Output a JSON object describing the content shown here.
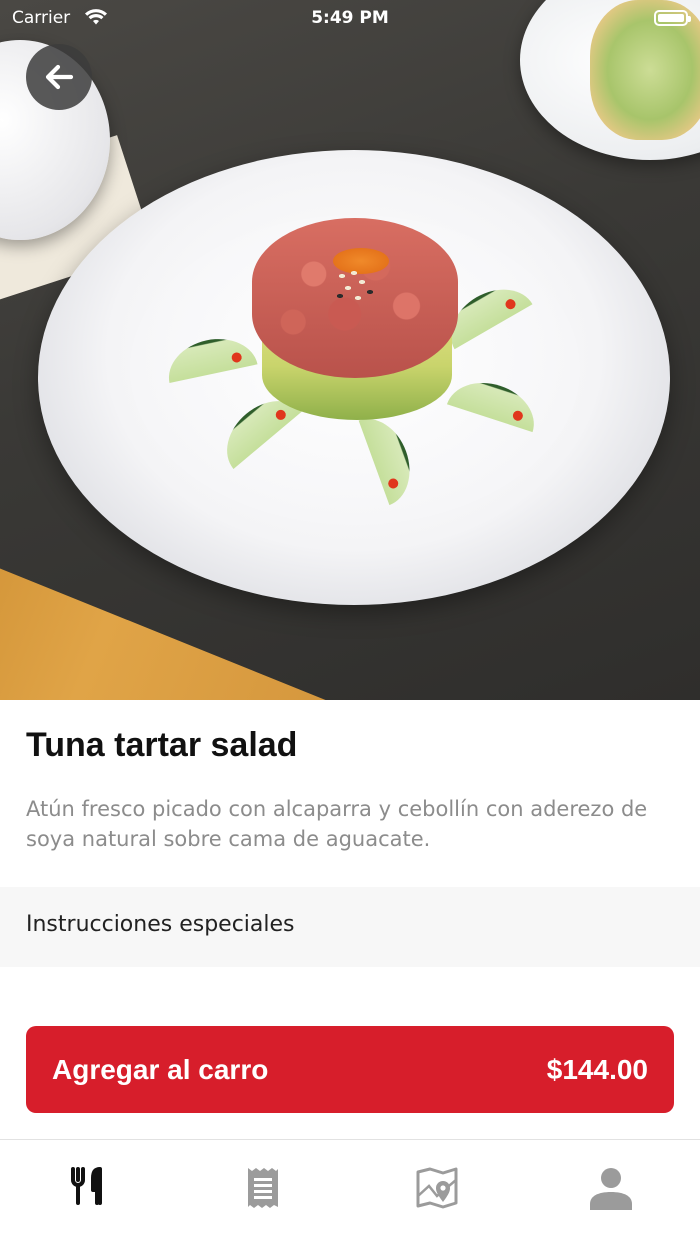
{
  "status_bar": {
    "carrier": "Carrier",
    "time": "5:49 PM"
  },
  "header": {
    "back_icon": "arrow-left-icon"
  },
  "product": {
    "name": "Tuna tartar salad",
    "description": "Atún fresco picado con alcaparra y cebollín con aderezo de soya natural sobre cama de aguacate."
  },
  "special_instructions": {
    "label": "Instrucciones especiales",
    "placeholder": "",
    "value": ""
  },
  "cart_button": {
    "label": "Agregar al carro",
    "price": "$144.00"
  },
  "tabs": [
    {
      "icon": "fork-knife-icon",
      "active": true
    },
    {
      "icon": "receipt-icon",
      "active": false
    },
    {
      "icon": "map-pin-icon",
      "active": false
    },
    {
      "icon": "user-icon",
      "active": false
    }
  ],
  "colors": {
    "accent": "#d71e2b",
    "tab_active": "#111111",
    "tab_inactive": "#9b9b9b"
  }
}
